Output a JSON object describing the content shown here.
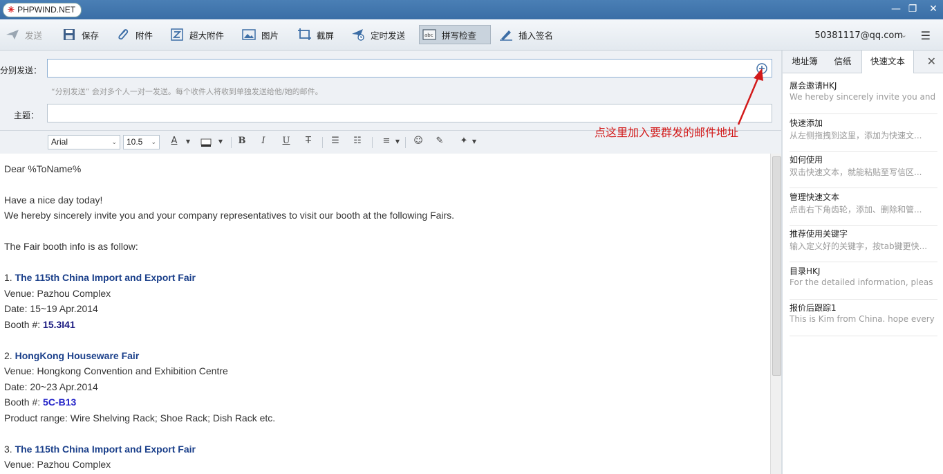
{
  "window": {
    "brand": "PHPWIND.NET",
    "minimize": "—",
    "restore": "❐",
    "close": "✕"
  },
  "toolbar": {
    "items": [
      {
        "label": "发送",
        "icon": "send-icon",
        "state": "disabled"
      },
      {
        "label": "保存",
        "icon": "save-icon",
        "state": "normal"
      },
      {
        "label": "附件",
        "icon": "paperclip-icon",
        "state": "normal"
      },
      {
        "label": "超大附件",
        "icon": "large-attachment-icon",
        "state": "normal"
      },
      {
        "label": "图片",
        "icon": "image-icon",
        "state": "normal"
      },
      {
        "label": "截屏",
        "icon": "screenshot-icon",
        "state": "normal"
      },
      {
        "label": "定时发送",
        "icon": "timed-send-icon",
        "state": "normal"
      },
      {
        "label": "拼写检查",
        "icon": "spellcheck-icon",
        "state": "active"
      },
      {
        "label": "插入签名",
        "icon": "signature-icon",
        "state": "normal"
      }
    ],
    "account": "50381117@qq.com",
    "account_dropdown": "⌄",
    "menu_glyph": "☰"
  },
  "compose": {
    "to_label": "分别发送：",
    "to_value": "",
    "to_hint": "“分别发送” 会对多个人一对一发送。每个收件人将收到单独发送给他/她的邮件。",
    "subject_label": "主题：",
    "subject_value": ""
  },
  "format": {
    "font": "Arial",
    "size": "10.5",
    "dd": "⌄",
    "a_glyph": "A",
    "bold": "B",
    "italic": "I",
    "underline": "U",
    "strike": "T",
    "ul": "☰",
    "ol": "☷",
    "align": "≡",
    "emoji": "☺",
    "clear": "✎",
    "magic": "✦"
  },
  "body": {
    "l1": "Dear %ToName%",
    "l2": "Have a nice day today!",
    "l3": "We hereby sincerely invite you and your company representatives to visit our booth at the following Fairs.",
    "l4": "The Fair booth info is as follow:",
    "f1_num": "1.",
    "f1_name": "The 115th China Import and Export Fair",
    "f1_venue": "Venue: Pazhou Complex",
    "f1_date": "Date: 15~19 Apr.2014",
    "f1_booth_label": "Booth #:",
    "f1_booth": "15.3I41",
    "f2_num": "2.",
    "f2_name": "HongKong Houseware Fair",
    "f2_venue": "Venue: Hongkong Convention and Exhibition Centre",
    "f2_date": "Date: 20~23 Apr.2014",
    "f2_booth_label": "Booth #:",
    "f2_booth": "5C-B13",
    "f2_range": "Product range: Wire Shelving Rack; Shoe Rack; Dish Rack etc.",
    "f3_num": "3.",
    "f3_name": "The 115th China Import and Export Fair",
    "f3_venue": "Venue: Pazhou Complex"
  },
  "annotation": {
    "text": "点这里加入要群发的邮件地址",
    "color": "#d21a1a"
  },
  "panel": {
    "tabs": [
      "地址簿",
      "信纸",
      "快速文本"
    ],
    "close": "✕",
    "items": [
      {
        "title": "展会邀请HKJ",
        "sub": "We hereby sincerely invite you and"
      },
      {
        "title": "快速添加",
        "sub": "从左侧拖拽到这里，添加为快速文..."
      },
      {
        "title": "如何使用",
        "sub": "双击快速文本，就能粘贴至写信区..."
      },
      {
        "title": "管理快速文本",
        "sub": "点击右下角齿轮，添加、删除和管..."
      },
      {
        "title": "推荐使用关键字",
        "sub": "输入定义好的关键字，按tab键更快..."
      },
      {
        "title": "目录HKJ",
        "sub": "For the detailed information, pleas"
      },
      {
        "title": "报价后跟踪1",
        "sub": "This is Kim from China. hope every"
      }
    ]
  },
  "colors": {
    "titlebar": "#3a6ea6",
    "accent": "#1a3f8a",
    "booth": "#1a1a80"
  }
}
